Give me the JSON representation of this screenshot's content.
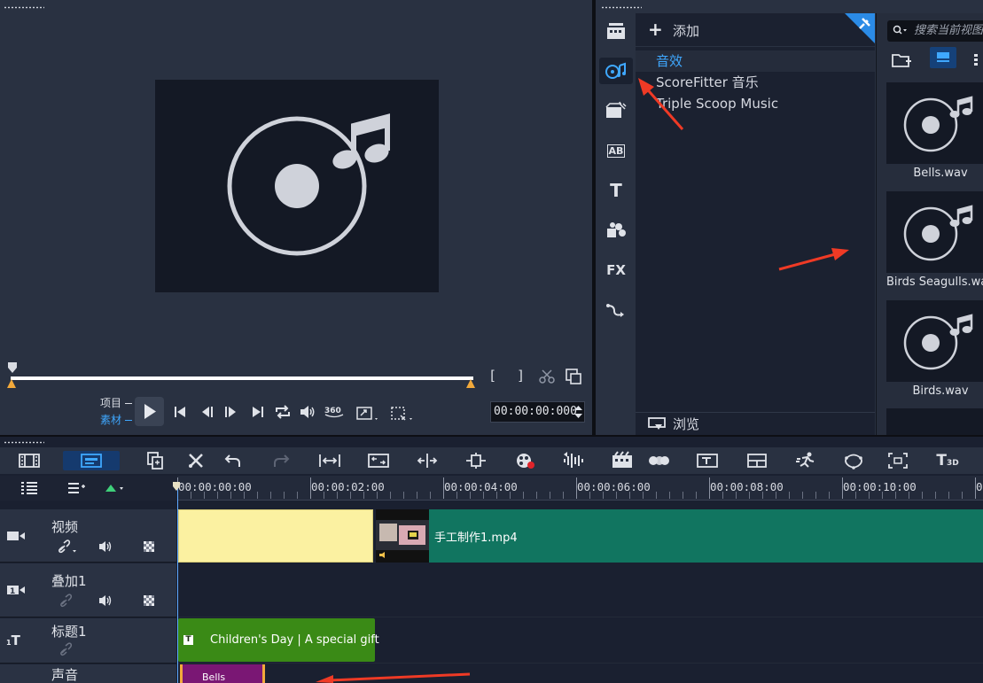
{
  "preview": {
    "mode_project": "项目",
    "mode_clip": "素材",
    "timecode": "00:00:00:000",
    "controls": [
      "play",
      "home",
      "prev-frame",
      "next-frame",
      "end",
      "repeat",
      "volume",
      "360",
      "resize",
      "crop"
    ],
    "trim_marks": [
      "[",
      "]"
    ]
  },
  "library": {
    "add_label": "添加",
    "folders": [
      "音效",
      "ScoreFitter 音乐",
      "Triple Scoop Music"
    ],
    "selected_folder": "音效",
    "browse_label": "浏览",
    "search_placeholder": "搜索当前视图",
    "thumbnails": [
      "Bells.wav",
      "Birds Seagulls.wav",
      "Birds.wav"
    ],
    "side_fx_label": "FX",
    "side_ab_label": "AB",
    "side_title_label": "T"
  },
  "timeline": {
    "ruler_ticks": [
      "00:00:00:00",
      "00:00:02:00",
      "00:00:04:00",
      "00:00:06:00",
      "00:00:08:00",
      "00:00:10:00",
      "0"
    ],
    "tracks": [
      {
        "name": "视频",
        "icon": "video-track-icon"
      },
      {
        "name": "叠加1",
        "icon": "overlay-track-icon"
      },
      {
        "name": "标题1",
        "icon": "title-track-icon"
      },
      {
        "name": "声音",
        "icon": "voice-track-icon"
      }
    ],
    "video_clip_name": "手工制作1.mp4",
    "title_clip_text": "Children's Day | A special gift",
    "audio_clip_text": "Bells",
    "title3d_label": "3D"
  },
  "colors": {
    "accent": "#3fa8ff",
    "yellow_clip": "#fbf1a1",
    "video_clip": "#117560",
    "title_clip": "#3a8a16",
    "audio_clip": "#7a1774",
    "arrow": "#ef3a25"
  }
}
